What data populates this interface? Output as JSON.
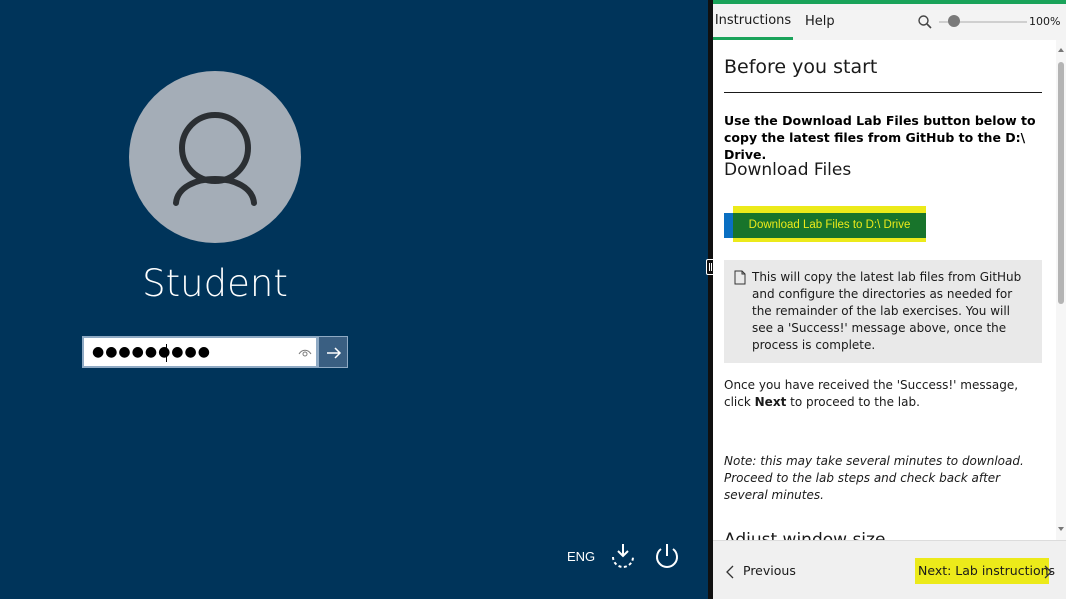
{
  "login": {
    "username": "Student",
    "password_masked": "●●●●●●●●●",
    "language": "ENG",
    "icons": {
      "avatar": "user-avatar-icon",
      "reveal": "reveal-password-icon",
      "submit": "arrow-right-icon",
      "ease": "ease-of-access-icon",
      "power": "power-icon"
    },
    "colors": {
      "background": "#00345a",
      "avatar": "#a4adb7"
    }
  },
  "pane": {
    "tabs": [
      {
        "label": "Instructions",
        "active": true
      },
      {
        "label": "Help",
        "active": false
      }
    ],
    "zoom": {
      "value_label": "100%",
      "level": 100,
      "icon": "zoom-icon"
    },
    "content": {
      "heading": "Before you start",
      "lead": "Use the Download Lab Files button below to copy the latest files from GitHub to the D:\\ Drive.",
      "download_heading": "Download Files",
      "download_button": "Download Lab Files to D:\\ Drive",
      "note": "This will copy the latest lab files from GitHub and configure the directories as needed for the remainder of the lab exercises. You will see a 'Success!' message above, once the process is complete.",
      "next_para_before": "Once you have received the 'Success!' message, click ",
      "next_para_bold": "Next",
      "next_para_after": " to proceed to the lab.",
      "note_italic": "Note: this may take several minutes to download. Proceed to the lab steps and check back after several minutes.",
      "cut_heading": "Adjust window size"
    },
    "footer": {
      "previous": "Previous",
      "next": "Next: Lab instructions"
    },
    "colors": {
      "accent": "#1aa35a",
      "highlight": "#ecea1a",
      "download_button": "#18742b"
    }
  }
}
